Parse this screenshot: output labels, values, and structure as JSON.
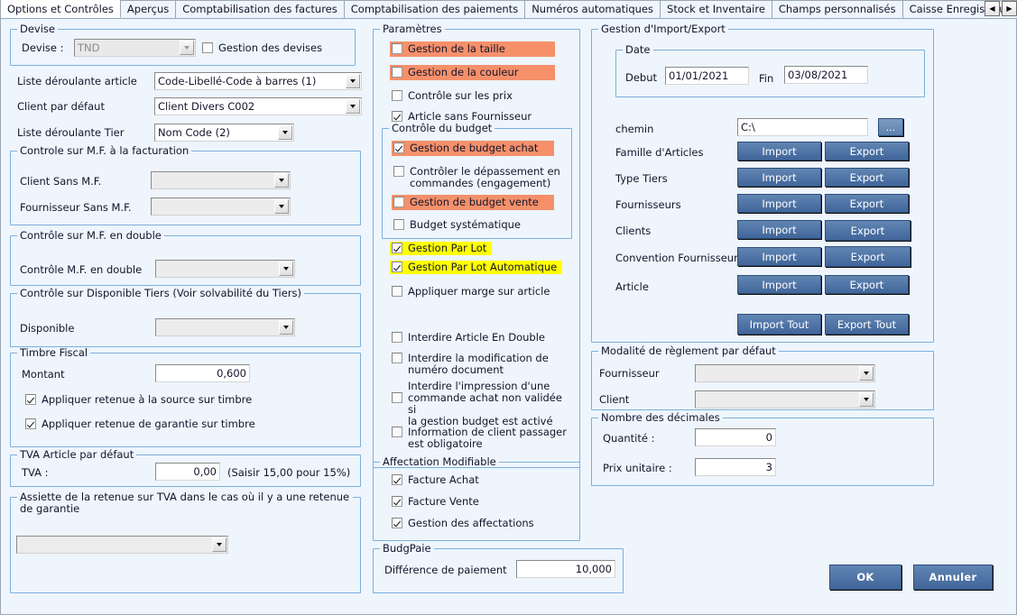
{
  "tabs": [
    {
      "label": "Options et Contrôles",
      "active": true
    },
    {
      "label": "Aperçus",
      "active": false
    },
    {
      "label": "Comptabilisation des factures",
      "active": false
    },
    {
      "label": "Comptabilisation des paiements",
      "active": false
    },
    {
      "label": "Numéros automatiques",
      "active": false
    },
    {
      "label": "Stock et Inventaire",
      "active": false
    },
    {
      "label": "Champs personnalisés",
      "active": false
    },
    {
      "label": "Caisse Enregistreuse",
      "active": false
    }
  ],
  "tab_scroll": {
    "left_icon": "triangle-left-icon",
    "right_icon": "triangle-right-icon"
  },
  "devise": {
    "title": "Devise",
    "label": "Devise :",
    "value": "TND",
    "checkbox_label": "Gestion des devises",
    "checked": false
  },
  "left": {
    "liste_article_label": "Liste déroulante article",
    "liste_article_value": "Code-Libellé-Code à barres (1)",
    "client_defaut_label": "Client par défaut",
    "client_defaut_value": "Client Divers C002",
    "liste_tier_label": "Liste déroulante Tier",
    "liste_tier_value": "Nom Code (2)"
  },
  "controle_mf_facturation": {
    "title": "Controle sur M.F. à la facturation",
    "client_label": "Client Sans M.F.",
    "client_value": "",
    "fournisseur_label": "Fournisseur Sans M.F.",
    "fournisseur_value": ""
  },
  "controle_mf_double": {
    "title": "Contrôle sur M.F. en double",
    "label": "Contrôle M.F. en double",
    "value": ""
  },
  "controle_disponible": {
    "title": "Contrôle sur Disponible Tiers (Voir solvabilité du Tiers)",
    "label": "Disponible",
    "value": ""
  },
  "timbre_fiscal": {
    "title": "Timbre Fiscal",
    "montant_label": "Montant",
    "montant_value": "0,600",
    "cb_source_label": "Appliquer retenue à la source sur timbre",
    "cb_source_checked": true,
    "cb_garantie_label": "Appliquer retenue de garantie sur timbre",
    "cb_garantie_checked": true
  },
  "tva": {
    "title": "TVA Article par défaut",
    "label": "TVA :",
    "value": "0,00",
    "hint": "(Saisir 15,00 pour 15%)"
  },
  "assiette": {
    "title": "Assiette de la retenue sur TVA dans le cas où il y a une retenue de garantie",
    "value": ""
  },
  "parametres": {
    "title": "Paramètres",
    "items": [
      {
        "label": "Gestion de la taille",
        "checked": false,
        "highlight": "orange"
      },
      {
        "label": "Gestion de la couleur",
        "checked": false,
        "highlight": "orange"
      },
      {
        "label": "Contrôle sur les prix",
        "checked": false,
        "highlight": "none"
      },
      {
        "label": "Article sans Fournisseur",
        "checked": true,
        "highlight": "none"
      }
    ],
    "budget": {
      "title": "Contrôle du budget",
      "items": [
        {
          "label": "Gestion de budget achat",
          "checked": true,
          "highlight": "orange"
        },
        {
          "label": "Contrôler le dépassement en\ncommandes (engagement)",
          "checked": false,
          "highlight": "none"
        },
        {
          "label": "Gestion de budget vente",
          "checked": false,
          "highlight": "orange"
        },
        {
          "label": "Budget systématique",
          "checked": false,
          "highlight": "none"
        }
      ]
    },
    "lots": [
      {
        "label": "Gestion Par Lot",
        "checked": true,
        "highlight": "yellow"
      },
      {
        "label": "Gestion Par Lot Automatique",
        "checked": true,
        "highlight": "yellow"
      }
    ],
    "marge": {
      "label": "Appliquer marge sur article",
      "checked": false,
      "highlight": "none"
    },
    "interdits": [
      {
        "label": "Interdire Article En Double",
        "checked": false,
        "highlight": "none"
      },
      {
        "label": "Interdire la modification de\nnuméro document",
        "checked": false,
        "highlight": "none"
      },
      {
        "label": "Interdire l'impression d'une\ncommande achat non validée si\nla gestion budget est activé",
        "checked": false,
        "highlight": "none"
      },
      {
        "label": "Information de client passager\nest obligatoire",
        "checked": false,
        "highlight": "none"
      }
    ]
  },
  "affectation": {
    "title": "Affectation Modifiable",
    "items": [
      {
        "label": "Facture Achat",
        "checked": true
      },
      {
        "label": "Facture Vente",
        "checked": true
      },
      {
        "label": "Gestion des affectations",
        "checked": true
      }
    ]
  },
  "budgpaie": {
    "title": "BudgPaie",
    "label": "Différence de paiement",
    "value": "10,000"
  },
  "import_export": {
    "title": "Gestion d'Import/Export",
    "date": {
      "title": "Date",
      "debut_label": "Debut",
      "debut_value": "01/01/2021",
      "fin_label": "Fin",
      "fin_value": "03/08/2021"
    },
    "chemin_label": "chemin",
    "chemin_value": "C:\\",
    "browse_label": "...",
    "rows": [
      {
        "label": "Famille d'Articles",
        "import_label": "Import",
        "export_label": "Export"
      },
      {
        "label": "Type Tiers",
        "import_label": "Import",
        "export_label": "Export"
      },
      {
        "label": "Fournisseurs",
        "import_label": "Import",
        "export_label": "Export"
      },
      {
        "label": "Clients",
        "import_label": "Import",
        "export_label": "Export"
      },
      {
        "label": "Convention Fournisseur",
        "import_label": "Import",
        "export_label": "Export"
      },
      {
        "label": "Article",
        "import_label": "Import",
        "export_label": "Export"
      }
    ],
    "import_tout_label": "Import Tout",
    "export_tout_label": "Export Tout"
  },
  "modalite": {
    "title": "Modalité de règlement par défaut",
    "fournisseur_label": "Fournisseur",
    "fournisseur_value": "",
    "client_label": "Client",
    "client_value": ""
  },
  "decimales": {
    "title": "Nombre des décimales",
    "quantite_label": "Quantité :",
    "quantite_value": "0",
    "prix_label": "Prix unitaire :",
    "prix_value": "3"
  },
  "footer": {
    "ok_label": "OK",
    "cancel_label": "Annuler"
  },
  "colors": {
    "background": "#eef5fd",
    "group_border": "#7cb0dc",
    "highlight_orange": "#f5906b",
    "highlight_yellow": "#ffff00",
    "button_blue": "#4f7cac"
  }
}
